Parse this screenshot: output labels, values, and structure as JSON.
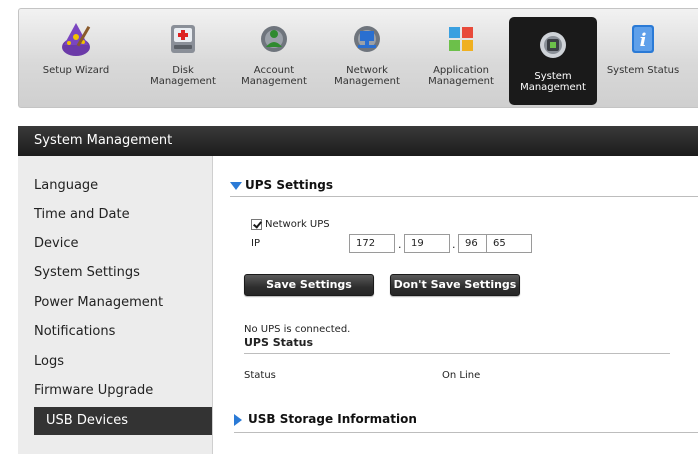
{
  "toolbar": {
    "items": [
      {
        "label": "Setup Wizard",
        "icon": "wizard-icon"
      },
      {
        "label": "Disk\nManagement",
        "icon": "disk-management-icon"
      },
      {
        "label": "Account\nManagement",
        "icon": "account-management-icon"
      },
      {
        "label": "Network\nManagement",
        "icon": "network-management-icon"
      },
      {
        "label": "Application\nManagement",
        "icon": "application-management-icon"
      },
      {
        "label": "System\nManagement",
        "icon": "system-management-icon",
        "active": true
      },
      {
        "label": "System Status",
        "icon": "system-status-icon"
      }
    ]
  },
  "section": {
    "title": "System Management"
  },
  "sidebar": {
    "items": [
      {
        "label": "Language"
      },
      {
        "label": "Time and Date"
      },
      {
        "label": "Device"
      },
      {
        "label": "System Settings"
      },
      {
        "label": "Power Management"
      },
      {
        "label": "Notifications"
      },
      {
        "label": "Logs"
      },
      {
        "label": "Firmware Upgrade"
      },
      {
        "label": "USB Devices",
        "active": true
      }
    ]
  },
  "ups_settings": {
    "title": "UPS Settings",
    "network_ups_label": "Network UPS",
    "network_ups_checked": true,
    "ip_label": "IP",
    "ip": [
      "172",
      "19",
      "96",
      "65"
    ],
    "save_label": "Save Settings",
    "dont_save_label": "Don't Save Settings",
    "connection_message": "No UPS is connected."
  },
  "ups_status": {
    "title": "UPS Status",
    "status_label": "Status",
    "status_value": "On Line"
  },
  "usb_storage": {
    "title": "USB Storage Information"
  },
  "colors": {
    "accent": "#2a7ad6",
    "header_bg": "#1c1c1c",
    "active_nav": "#333333"
  }
}
